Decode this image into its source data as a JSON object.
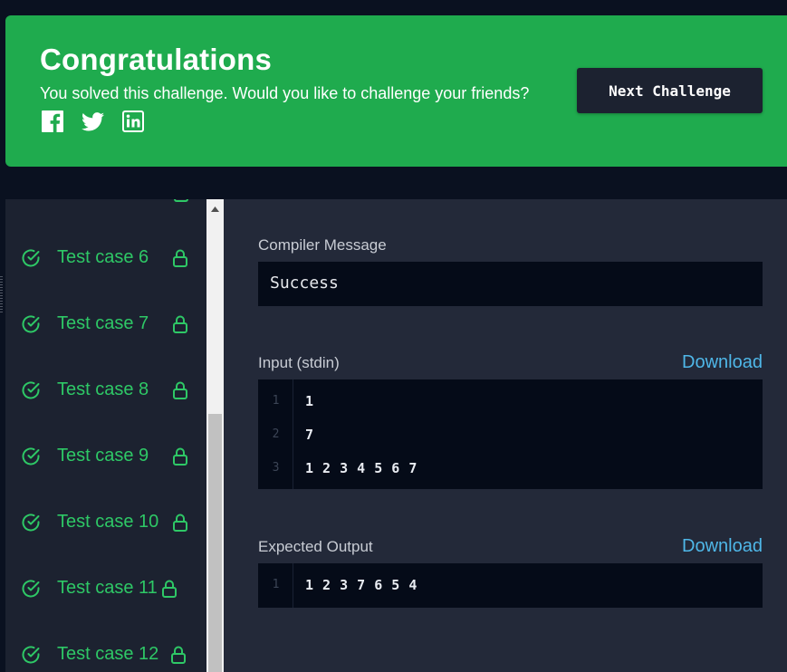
{
  "banner": {
    "title": "Congratulations",
    "subtitle": "You solved this challenge. Would you like to challenge your friends?",
    "share_icons": [
      "facebook-icon",
      "twitter-icon",
      "linkedin-icon"
    ],
    "next_button": "Next Challenge",
    "color": "#1fab4e"
  },
  "sidebar": {
    "test_cases": [
      {
        "label": "Test case 6",
        "status": "passed",
        "locked": true
      },
      {
        "label": "Test case 7",
        "status": "passed",
        "locked": true
      },
      {
        "label": "Test case 8",
        "status": "passed",
        "locked": true
      },
      {
        "label": "Test case 9",
        "status": "passed",
        "locked": true
      },
      {
        "label": "Test case 10",
        "status": "passed",
        "locked": true
      },
      {
        "label": "Test case 11",
        "status": "passed",
        "locked": true
      },
      {
        "label": "Test case 12",
        "status": "passed",
        "locked": true
      }
    ],
    "pass_color": "#2ec866"
  },
  "compiler": {
    "label": "Compiler Message",
    "message": "Success"
  },
  "input": {
    "label": "Input (stdin)",
    "download": "Download",
    "lines": [
      {
        "num": "1",
        "text": "1"
      },
      {
        "num": "2",
        "text": "7"
      },
      {
        "num": "3",
        "text": "1 2 3 4 5 6 7"
      }
    ]
  },
  "expected": {
    "label": "Expected Output",
    "download": "Download",
    "lines": [
      {
        "num": "1",
        "text": "1 2 3 7 6 5 4"
      }
    ]
  }
}
